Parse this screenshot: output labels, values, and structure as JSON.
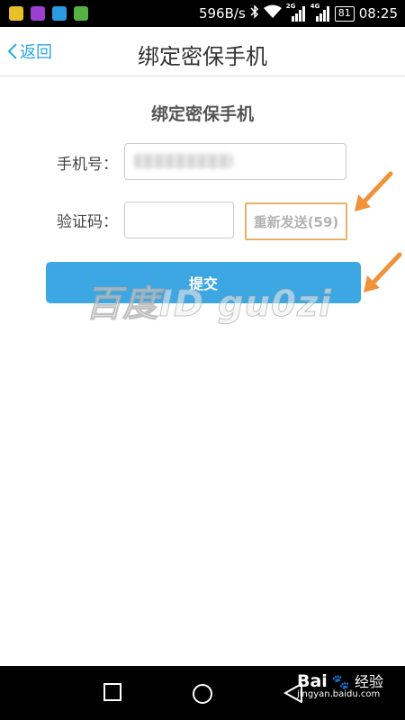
{
  "status_bar": {
    "net_speed": "596B/s",
    "signal1_tag": "2G",
    "signal2_tag": "4G",
    "battery": "81",
    "time": "08:25"
  },
  "header": {
    "back_label": "返回",
    "title": "绑定密保手机"
  },
  "form": {
    "title": "绑定密保手机",
    "phone_label": "手机号：",
    "code_label": "验证码：",
    "code_value": "",
    "resend_label": "重新发送(59)",
    "submit_label": "提交"
  },
  "watermark": "百度ID gu0zi",
  "logo": {
    "brand": "Bai",
    "suffix": "经验",
    "url": "jingyan.baidu.com"
  },
  "colors": {
    "accent": "#2aa7e4",
    "submit_bg": "#3ca7e3",
    "resend_border": "#e6b363",
    "annotation_arrow": "#f0923a"
  }
}
